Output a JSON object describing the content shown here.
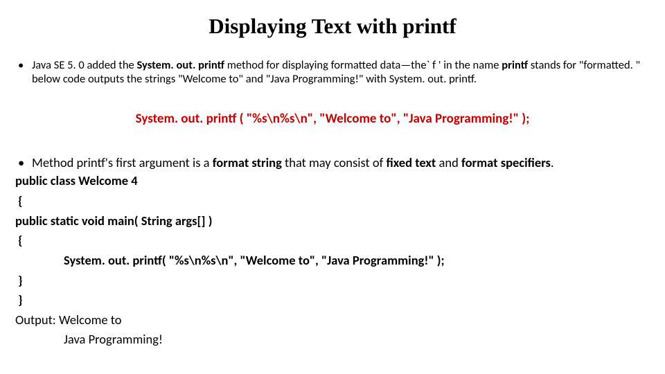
{
  "title": "Displaying Text with printf",
  "bullet1": {
    "pre": " Java SE 5. 0 added the ",
    "bold1": "System. out. printf",
    "mid1": " method for displaying formatted data—the` f ' in the name ",
    "bold2": "printf",
    "mid2": " stands for \"formatted. \" below code outputs the strings \"Welcome to\" and \"Java Programming!\" with System. out. printf."
  },
  "centerCode": "System. out. printf ( \"%s\\n%s\\n\", \"Welcome to\", \"Java Programming!\" );",
  "bullet2": {
    "pre": "  Method printf's first argument is a ",
    "b1": "format string",
    "mid": " that may consist of ",
    "b2": "fixed text",
    "mid2": " and ",
    "b3": "format specifiers",
    "post": "."
  },
  "code": {
    "l1": "public class Welcome 4",
    "l2": " {",
    "l3": "public static void main( String args[] )",
    "l4": " {",
    "l5": "System. out. printf( \"%s\\n%s\\n\", \"Welcome to\", \"Java Programming!\" );",
    "l6": " }",
    "l7": " }"
  },
  "output": {
    "label": "Output: ",
    "l1": "Welcome to",
    "l2": "Java Programming!"
  }
}
